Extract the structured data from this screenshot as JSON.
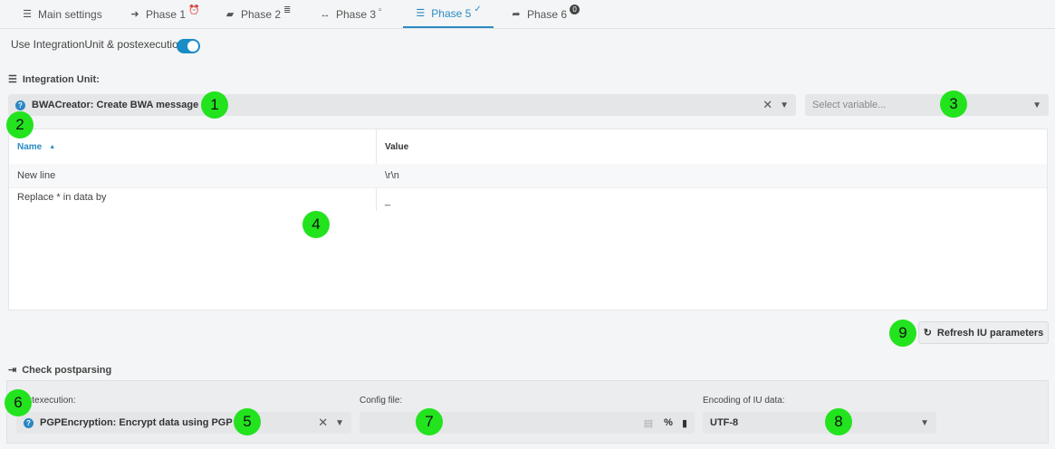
{
  "tabs": [
    {
      "label": "Main settings",
      "icon": "list-icon",
      "glyph": "☰",
      "sup": ""
    },
    {
      "label": "Phase 1",
      "icon": "arrow-to-line-icon",
      "glyph": "➜",
      "sup": "⏰"
    },
    {
      "label": "Phase 2",
      "icon": "file-edit-icon",
      "glyph": "▰",
      "sup": "≣"
    },
    {
      "label": "Phase 3",
      "icon": "double-arrow-icon",
      "glyph": "↔",
      "sup": "▫"
    },
    {
      "label": "Phase 5",
      "icon": "server-icon",
      "glyph": "☰",
      "sup": "✓"
    },
    {
      "label": "Phase 6",
      "icon": "share-icon",
      "glyph": "➦",
      "sup": "0"
    }
  ],
  "use_integration_label": "Use IntegrationUnit & postexecution",
  "integration_unit": {
    "title": "Integration Unit:",
    "selected": "BWACreator: Create BWA message",
    "variable_placeholder": "Select variable..."
  },
  "table": {
    "headers": {
      "name": "Name",
      "value": "Value"
    },
    "rows": [
      {
        "name": "New line",
        "value": "\\r\\n"
      },
      {
        "name": "Replace * in data by",
        "value": "_"
      }
    ]
  },
  "refresh_button": "Refresh IU parameters",
  "check_postparsing": "Check postparsing",
  "postexecution": {
    "label": "Postexecution:",
    "value": "PGPEncryption: Encrypt data using PGP"
  },
  "config_file": {
    "label": "Config file:",
    "value": ""
  },
  "encoding": {
    "label": "Encoding of IU data:",
    "value": "UTF-8"
  },
  "markers": [
    "1",
    "2",
    "3",
    "4",
    "5",
    "6",
    "7",
    "8",
    "9"
  ],
  "colors": {
    "accent": "#2b8bc4",
    "marker": "#22e31e"
  }
}
